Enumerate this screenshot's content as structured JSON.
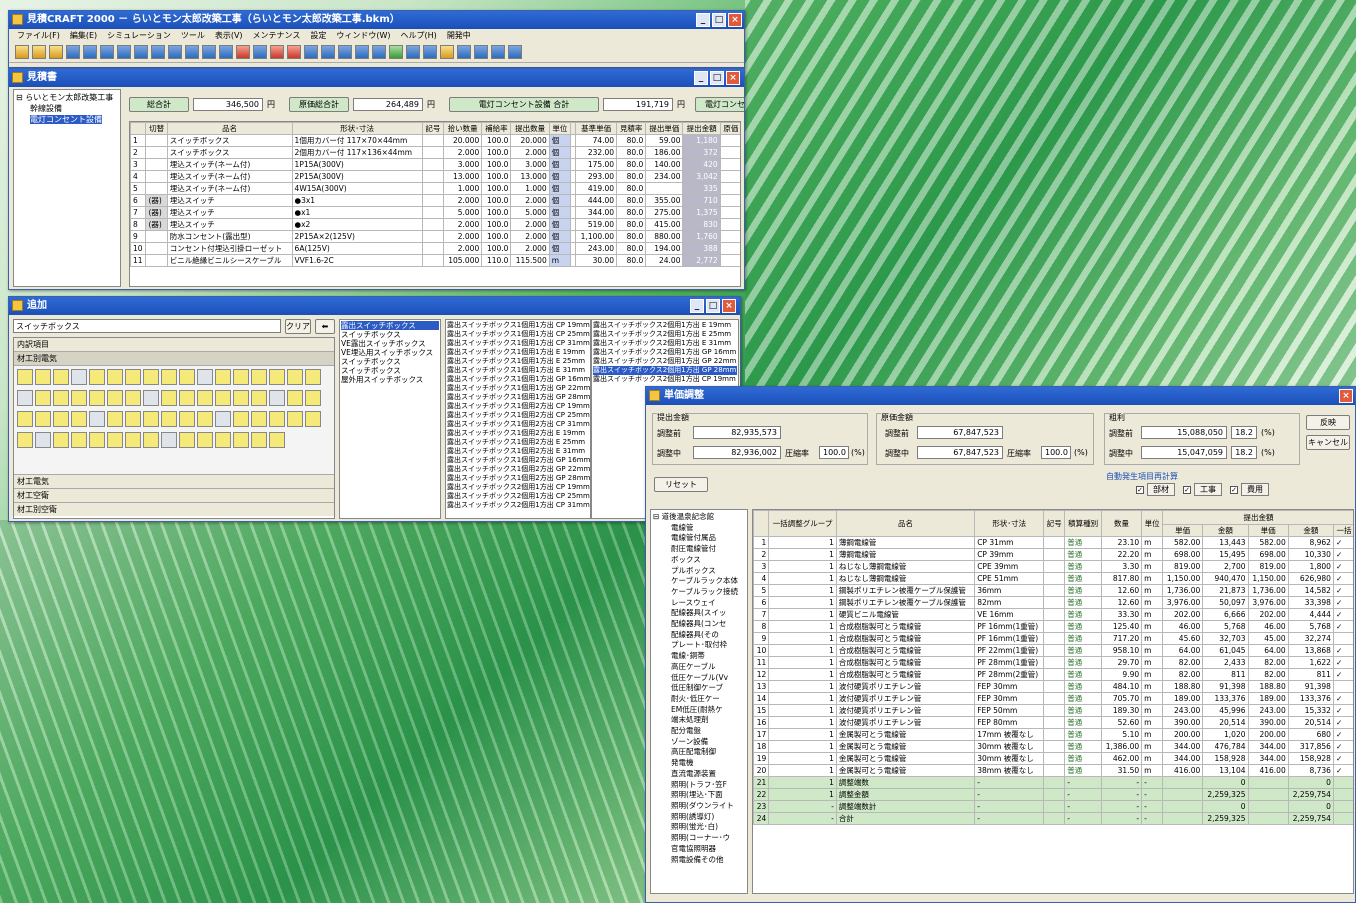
{
  "main_window": {
    "title": "見積CRAFT 2000 － らいとモン太郎改築工事（らいとモン太郎改築工事.bkm）",
    "menu": [
      "ファイル(F)",
      "編集(E)",
      "シミュレーション",
      "ツール",
      "表示(V)",
      "メンテナンス",
      "設定",
      "ウィンドウ(W)",
      "ヘルプ(H)",
      "開発中"
    ]
  },
  "estimate": {
    "title": "見積書",
    "tree": [
      "らいとモン太郎改築工事",
      "幹線設備",
      "電灯コンセント設備"
    ],
    "summary": {
      "total_label": "総合計",
      "total_value": "346,500",
      "yen": "円",
      "cost_label": "原価総合計",
      "cost_value": "264,489",
      "section_label": "電灯コンセント設備 合計",
      "section_value": "191,719",
      "section2_label": "電灯コンセ"
    },
    "headers": [
      "",
      "切替",
      "品名",
      "形状･寸法",
      "記号",
      "拾い数量",
      "補給率",
      "提出数量",
      "単位",
      "",
      "基準単価",
      "見積率",
      "提出単価",
      "提出金額",
      "原価"
    ],
    "rows": [
      [
        "1",
        "",
        "スイッチボックス",
        "1個用カバー付 117×70×44mm",
        "",
        "20.000",
        "100.0",
        "20.000",
        "個",
        "",
        "74.00",
        "80.0",
        "59.00",
        "1,180"
      ],
      [
        "2",
        "",
        "スイッチボックス",
        "2個用カバー付 117×136×44mm",
        "",
        "2.000",
        "100.0",
        "2.000",
        "個",
        "",
        "232.00",
        "80.0",
        "186.00",
        "372"
      ],
      [
        "3",
        "",
        "埋込スイッチ(ネーム付)",
        "1P15A(300V)",
        "",
        "3.000",
        "100.0",
        "3.000",
        "個",
        "",
        "175.00",
        "80.0",
        "140.00",
        "420"
      ],
      [
        "4",
        "",
        "埋込スイッチ(ネーム付)",
        "2P15A(300V)",
        "",
        "13.000",
        "100.0",
        "13.000",
        "個",
        "",
        "293.00",
        "80.0",
        "234.00",
        "3,042"
      ],
      [
        "5",
        "",
        "埋込スイッチ(ネーム付)",
        "4W15A(300V)",
        "",
        "1.000",
        "100.0",
        "1.000",
        "個",
        "",
        "419.00",
        "80.0",
        "",
        "335"
      ],
      [
        "6",
        "(器)",
        "埋込スイッチ",
        "●3x1",
        "",
        "2.000",
        "100.0",
        "2.000",
        "個",
        "",
        "444.00",
        "80.0",
        "355.00",
        "710"
      ],
      [
        "7",
        "(器)",
        "埋込スイッチ",
        "●x1",
        "",
        "5.000",
        "100.0",
        "5.000",
        "個",
        "",
        "344.00",
        "80.0",
        "275.00",
        "1,375"
      ],
      [
        "8",
        "(器)",
        "埋込スイッチ",
        "●x2",
        "",
        "2.000",
        "100.0",
        "2.000",
        "個",
        "",
        "519.00",
        "80.0",
        "415.00",
        "830"
      ],
      [
        "9",
        "",
        "防水コンセント(露出型)",
        "2P15A×2(125V)",
        "",
        "2.000",
        "100.0",
        "2.000",
        "個",
        "",
        "1,100.00",
        "80.0",
        "880.00",
        "1,760"
      ],
      [
        "10",
        "",
        "コンセント付埋込引掛ローゼット",
        "6A(125V)",
        "",
        "2.000",
        "100.0",
        "2.000",
        "個",
        "",
        "243.00",
        "80.0",
        "194.00",
        "388"
      ],
      [
        "11",
        "",
        "ビニル絶縁ビニルシースケーブル",
        "VVF1.6-2C",
        "",
        "105.000",
        "110.0",
        "115.500",
        "m",
        "",
        "30.00",
        "80.0",
        "24.00",
        "2,772"
      ]
    ]
  },
  "add_window": {
    "title": "追加",
    "search_value": "スイッチボックス",
    "clear_label": "クリア",
    "sections": [
      "内訳項目",
      "材工別電気"
    ],
    "bottom_sections": [
      "材工電気",
      "材工空衛",
      "材工別空衛"
    ],
    "list1": [
      "露出スイッチボックス",
      "スイッチボックス",
      "VE露出スイッチボックス",
      "VE埋込用スイッチボックス",
      "スイッチボックス",
      "スイッチボックス",
      "屋外用スイッチボックス"
    ],
    "list2": [
      "露出スイッチボックス1個用1方出 CP 19mm",
      "露出スイッチボックス1個用1方出 CP 25mm",
      "露出スイッチボックス1個用1方出 CP 31mm",
      "露出スイッチボックス1個用1方出 E 19mm",
      "露出スイッチボックス1個用1方出 E 25mm",
      "露出スイッチボックス1個用1方出 E 31mm",
      "露出スイッチボックス1個用1方出 GP 16mm",
      "露出スイッチボックス1個用1方出 GP 22mm",
      "露出スイッチボックス1個用1方出 GP 28mm",
      "露出スイッチボックス1個用2方出 CP 19mm",
      "露出スイッチボックス1個用2方出 CP 25mm",
      "露出スイッチボックス1個用2方出 CP 31mm",
      "露出スイッチボックス1個用2方出 E 19mm",
      "露出スイッチボックス1個用2方出 E 25mm",
      "露出スイッチボックス1個用2方出 E 31mm",
      "露出スイッチボックス1個用2方出 GP 16mm",
      "露出スイッチボックス1個用2方出 GP 22mm",
      "露出スイッチボックス1個用2方出 GP 28mm",
      "露出スイッチボックス2個用1方出 CP 19mm",
      "露出スイッチボックス2個用1方出 CP 25mm",
      "露出スイッチボックス2個用1方出 CP 31mm"
    ],
    "list3": [
      "露出スイッチボックス2個用1方出 E 19mm",
      "露出スイッチボックス2個用1方出 E 25mm",
      "露出スイッチボックス2個用1方出 E 31mm",
      "露出スイッチボックス2個用1方出 GP 16mm",
      "露出スイッチボックス2個用1方出 GP 22mm",
      "露出スイッチボックス2個用1方出 GP 28mm",
      "露出スイッチボックス2個用1方出 CP 19mm"
    ]
  },
  "unit_window": {
    "title": "単価調整",
    "submit_group": "提出金額",
    "before": "調整前",
    "during": "調整中",
    "submit_before": "82,935,573",
    "submit_during": "82,936,002",
    "rate_label": "圧縮率",
    "rate_value": "100.0",
    "pct": "(%)",
    "cost_group": "原価金額",
    "cost_before": "67,847,523",
    "cost_during": "67,847,523",
    "cost_rate": "100.0",
    "profit_group": "粗利",
    "profit_before": "15,088,050",
    "profit_before_pct": "18.2",
    "profit_during": "15,047,059",
    "profit_during_pct": "18.2",
    "ok_label": "反映",
    "cancel_label": "キャンセル",
    "reset_label": "リセット",
    "recalc_label": "自動発生項目再計算",
    "checks": [
      "部材",
      "工事",
      "費用"
    ],
    "tree": [
      "道後温泉記念館",
      "電線管",
      "電線管付属品",
      "耐圧電線管付",
      "ボックス",
      "プルボックス",
      "ケーブルラック本体",
      "ケーブルラック接続",
      "レースウェイ",
      "配線器具(スイッ",
      "配線器具(コンセ",
      "配線器具(その",
      "プレート･取付枠",
      "電線･銅帯",
      "高圧ケーブル",
      "低圧ケーブル(Vv",
      "低圧制御ケーブ",
      "耐火･低圧ケー",
      "EM低圧(耐熱ケ",
      "端末処理剤",
      "配分電盤",
      "ゾーン設備",
      "高圧配電制御",
      "発電機",
      "直流電源装置",
      "照明(トラフ･笠F",
      "照明(埋込･下面",
      "照明(ダウンライト",
      "照明(誘導灯)",
      "照明(蛍光･白)",
      "照明(コーナー･ウ",
      "官電協照明器",
      "照電設備その他"
    ],
    "headers1": [
      "",
      "一括調整グループ",
      "品名",
      "形状･寸法",
      "記号",
      "積算種別",
      "数量",
      "単位",
      "提出金額",
      "",
      "",
      "",
      "",
      ""
    ],
    "headers2": [
      "調整前",
      "調整中",
      "単価",
      "金額",
      "単価",
      "金額",
      "一括"
    ],
    "rows": [
      [
        "1",
        "1",
        "薄鋼電線管",
        "CP 31mm",
        "",
        "普通",
        "23.10",
        "m",
        "582.00",
        "13,443",
        "582.00",
        "8,962",
        "✓"
      ],
      [
        "2",
        "1",
        "薄鋼電線管",
        "CP 39mm",
        "",
        "普通",
        "22.20",
        "m",
        "698.00",
        "15,495",
        "698.00",
        "10,330",
        "✓"
      ],
      [
        "3",
        "1",
        "ねじなし薄鋼電線管",
        "CPE 39mm",
        "",
        "普通",
        "3.30",
        "m",
        "819.00",
        "2,700",
        "819.00",
        "1,800",
        "✓"
      ],
      [
        "4",
        "1",
        "ねじなし薄鋼電線管",
        "CPE 51mm",
        "",
        "普通",
        "817.80",
        "m",
        "1,150.00",
        "940,470",
        "1,150.00",
        "626,980",
        "✓"
      ],
      [
        "5",
        "1",
        "鋼製ポリエチレン被覆ケーブル保護管",
        "36mm",
        "",
        "普通",
        "12.60",
        "m",
        "1,736.00",
        "21,873",
        "1,736.00",
        "14,582",
        "✓"
      ],
      [
        "6",
        "1",
        "鋼製ポリエチレン被覆ケーブル保護管",
        "82mm",
        "",
        "普通",
        "12.60",
        "m",
        "3,976.00",
        "50,097",
        "3,976.00",
        "33,398",
        "✓"
      ],
      [
        "7",
        "1",
        "硬質ビニル電線管",
        "VE 16mm",
        "",
        "普通",
        "33.30",
        "m",
        "202.00",
        "6,666",
        "202.00",
        "4,444",
        "✓"
      ],
      [
        "8",
        "1",
        "合成樹脂製可とう電線管",
        "PF 16mm(1重管)",
        "",
        "普通",
        "125.40",
        "m",
        "46.00",
        "5,768",
        "46.00",
        "5,768",
        "✓"
      ],
      [
        "9",
        "1",
        "合成樹脂製可とう電線管",
        "PF 16mm(1重管)",
        "",
        "普通",
        "717.20",
        "m",
        "45.60",
        "32,703",
        "45.00",
        "32,274",
        ""
      ],
      [
        "10",
        "1",
        "合成樹脂製可とう電線管",
        "PF 22mm(1重管)",
        "",
        "普通",
        "958.10",
        "m",
        "64.00",
        "61,045",
        "64.00",
        "13,868",
        "✓"
      ],
      [
        "11",
        "1",
        "合成樹脂製可とう電線管",
        "PF 28mm(1重管)",
        "",
        "普通",
        "29.70",
        "m",
        "82.00",
        "2,433",
        "82.00",
        "1,622",
        "✓"
      ],
      [
        "12",
        "1",
        "合成樹脂製可とう電線管",
        "PF 28mm(2重管)",
        "",
        "普通",
        "9.90",
        "m",
        "82.00",
        "811",
        "82.00",
        "811",
        "✓"
      ],
      [
        "13",
        "1",
        "波付硬質ポリエチレン管",
        "FEP 30mm",
        "",
        "普通",
        "484.10",
        "m",
        "188.80",
        "91,398",
        "188.80",
        "91,398",
        ""
      ],
      [
        "14",
        "1",
        "波付硬質ポリエチレン管",
        "FEP 30mm",
        "",
        "普通",
        "705.70",
        "m",
        "189.00",
        "133,376",
        "189.00",
        "133,376",
        "✓"
      ],
      [
        "15",
        "1",
        "波付硬質ポリエチレン管",
        "FEP 50mm",
        "",
        "普通",
        "189.30",
        "m",
        "243.00",
        "45,996",
        "243.00",
        "15,332",
        "✓"
      ],
      [
        "16",
        "1",
        "波付硬質ポリエチレン管",
        "FEP 80mm",
        "",
        "普通",
        "52.60",
        "m",
        "390.00",
        "20,514",
        "390.00",
        "20,514",
        "✓"
      ],
      [
        "17",
        "1",
        "金属製可とう電線管",
        "17mm 被覆なし",
        "",
        "普通",
        "5.10",
        "m",
        "200.00",
        "1,020",
        "200.00",
        "680",
        "✓"
      ],
      [
        "18",
        "1",
        "金属製可とう電線管",
        "30mm 被覆なし",
        "",
        "普通",
        "1,386.00",
        "m",
        "344.00",
        "476,784",
        "344.00",
        "317,856",
        "✓"
      ],
      [
        "19",
        "1",
        "金属製可とう電線管",
        "30mm 被覆なし",
        "",
        "普通",
        "462.00",
        "m",
        "344.00",
        "158,928",
        "344.00",
        "158,928",
        "✓"
      ],
      [
        "20",
        "1",
        "金属製可とう電線管",
        "38mm 被覆なし",
        "",
        "普通",
        "31.50",
        "m",
        "416.00",
        "13,104",
        "416.00",
        "8,736",
        "✓"
      ]
    ],
    "green_rows": [
      [
        "21",
        "1",
        "調整端数",
        "-",
        "",
        "-",
        "-",
        "-",
        "",
        "0",
        "",
        "0",
        ""
      ],
      [
        "22",
        "1",
        "調整金額",
        "-",
        "",
        "-",
        "-",
        "-",
        "",
        "2,259,325",
        "",
        "2,259,754",
        ""
      ],
      [
        "23",
        "-",
        "調整端数計",
        "-",
        "",
        "-",
        "-",
        "-",
        "",
        "0",
        "",
        "0",
        ""
      ],
      [
        "24",
        "-",
        "合計",
        "-",
        "",
        "-",
        "-",
        "-",
        "",
        "2,259,325",
        "",
        "2,259,754",
        ""
      ]
    ]
  }
}
